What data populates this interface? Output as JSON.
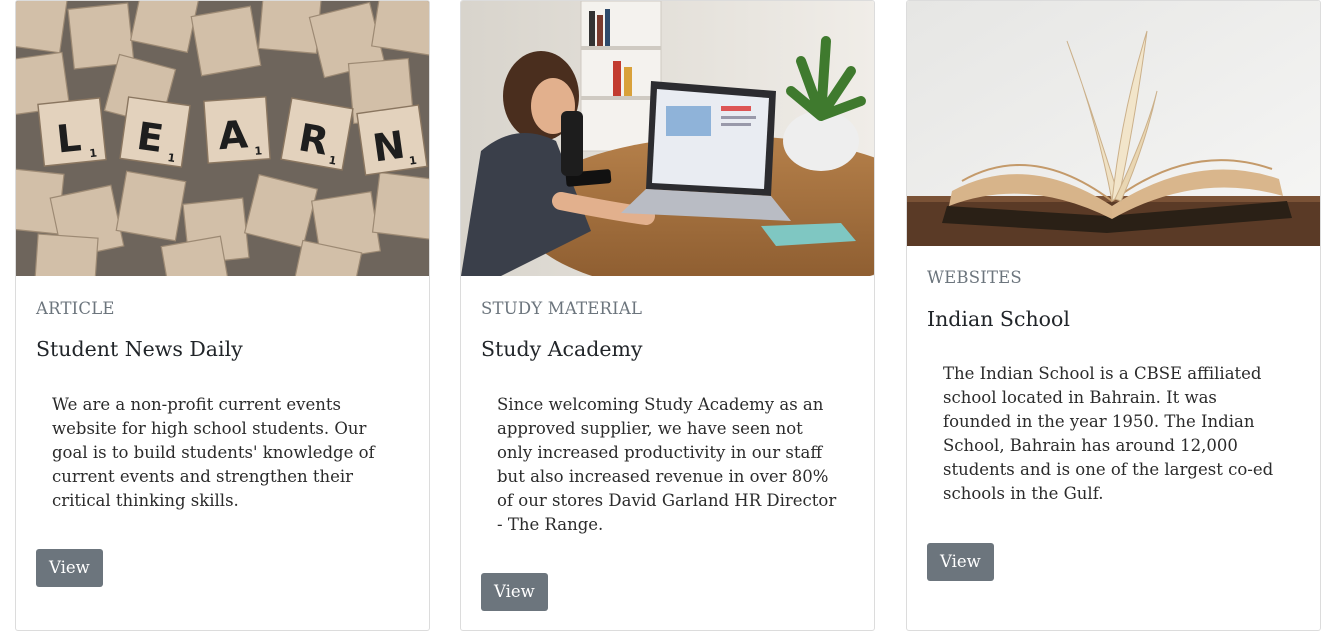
{
  "cards": [
    {
      "category": "ARTICLE",
      "title": "Student News Daily",
      "description": "We are a non-profit current events website for high school students. Our goal is to build students' knowledge of current events and strengthen their critical thinking skills.",
      "button_label": "View",
      "image_letters": [
        "L",
        "E",
        "A",
        "R",
        "N"
      ],
      "image_subscript": "1"
    },
    {
      "category": "STUDY MATERIAL",
      "title": "Study Academy",
      "description": "Since welcoming Study Academy as an approved supplier, we have seen not only increased productivity in our staff but also increased revenue in over 80% of our stores David Garland HR Director - The Range.",
      "button_label": "View"
    },
    {
      "category": "WEBSITES",
      "title": "Indian School",
      "description": "The Indian School is a CBSE affiliated school located in Bahrain. It was founded in the year 1950. The Indian School, Bahrain has around 12,000 students and is one of the largest co-ed schools in the Gulf.",
      "button_label": "View"
    }
  ],
  "colors": {
    "button_bg": "#6c757d",
    "muted_text": "#6c757d",
    "card_border": "#dcdcdc"
  }
}
